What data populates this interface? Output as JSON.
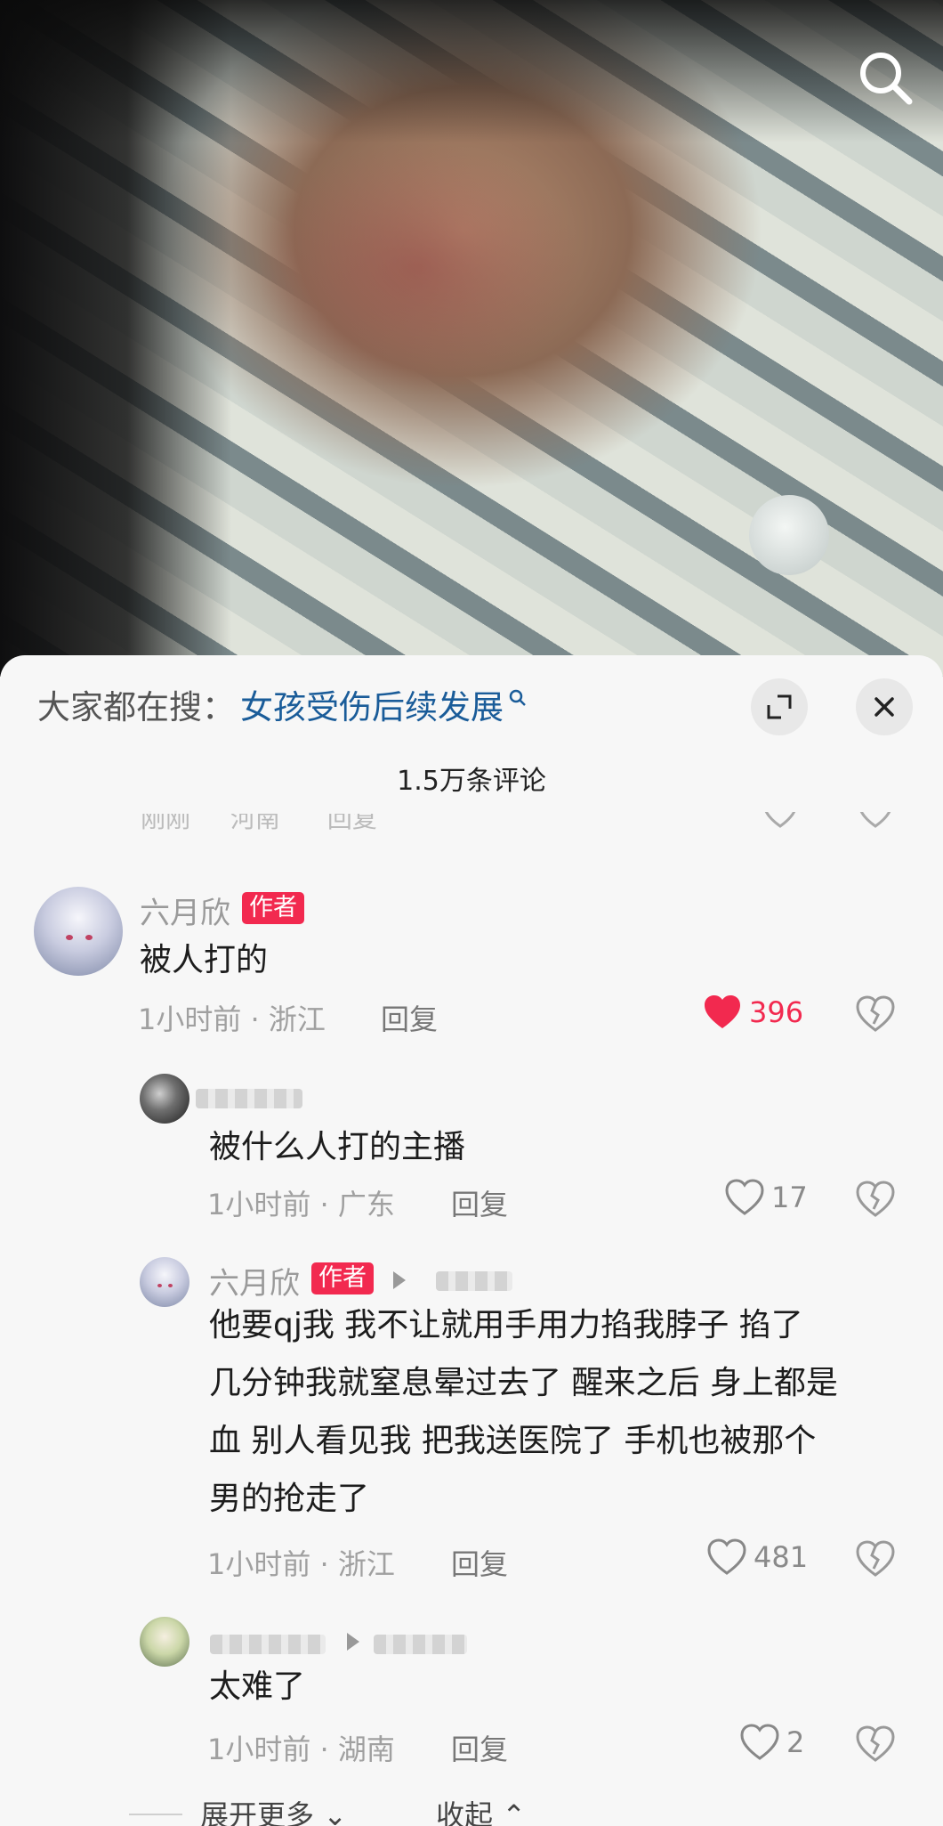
{
  "search": {
    "prefix": "大家都在搜：",
    "query": "女孩受伤后续发展"
  },
  "comments_count": "1.5万条评论",
  "cutoff_row": {
    "time": "刚刚",
    "location": "河南",
    "reply": "回复"
  },
  "comments": [
    {
      "name": "六月欣",
      "badge": "作者",
      "text": "被人打的",
      "time": "1小时前",
      "location": "浙江",
      "reply": "回复",
      "likes": "396",
      "liked": true
    }
  ],
  "replies": [
    {
      "text": "被什么人打的主播",
      "time": "1小时前",
      "location": "广东",
      "reply": "回复",
      "likes": "17"
    },
    {
      "name": "六月欣",
      "badge": "作者",
      "text_lines": [
        "他要qj我 我不让就用手用力掐我脖子 掐了",
        "几分钟我就窒息晕过去了 醒来之后 身上都是",
        "血 别人看见我 把我送医院了 手机也被那个",
        "男的抢走了"
      ],
      "time": "1小时前",
      "location": "浙江",
      "reply": "回复",
      "likes": "481"
    },
    {
      "text": "太难了",
      "time": "1小时前",
      "location": "湖南",
      "reply": "回复",
      "likes": "2"
    }
  ],
  "footer": {
    "expand_more": "展开更多",
    "collapse": "收起"
  },
  "colors": {
    "accent": "#f2294f",
    "link": "#1a5c99"
  }
}
